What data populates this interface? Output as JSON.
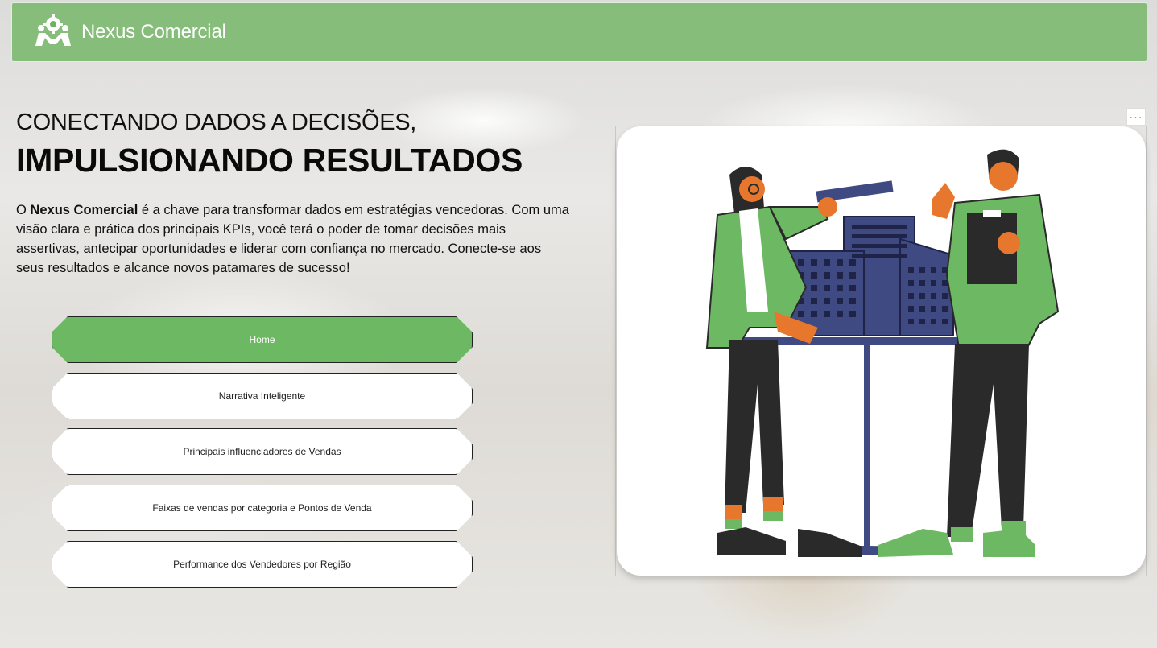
{
  "header": {
    "app_title": "Nexus Comercial",
    "logo_icon": "handshake-gear-icon"
  },
  "hero": {
    "line1": "CONECTANDO DADOS A DECISÕES,",
    "line2": "IMPULSIONANDO RESULTADOS"
  },
  "description": {
    "prefix": "O ",
    "brand": "Nexus Comercial",
    "rest": " é a chave para transformar dados em estratégias vencedoras. Com uma visão clara e prática dos principais KPIs, você terá o poder de tomar decisões mais assertivas, antecipar oportunidades e liderar com confiança no mercado. Conecte-se aos seus resultados e alcance novos patamares de sucesso!"
  },
  "nav": {
    "items": [
      {
        "label": "Home",
        "active": true
      },
      {
        "label": "Narrativa Inteligente",
        "active": false
      },
      {
        "label": "Principais influenciadores de Vendas",
        "active": false
      },
      {
        "label": "Faixas de vendas por categoria e Pontos de Venda",
        "active": false
      },
      {
        "label": "Performance dos Vendedores por Região",
        "active": false
      }
    ]
  },
  "visual": {
    "more_options_label": "···",
    "illustration": "business-team-illustration"
  },
  "colors": {
    "accent_green": "#6db862",
    "header_green": "#6eb45f",
    "navy": "#3f4a82",
    "orange": "#e8772e"
  }
}
